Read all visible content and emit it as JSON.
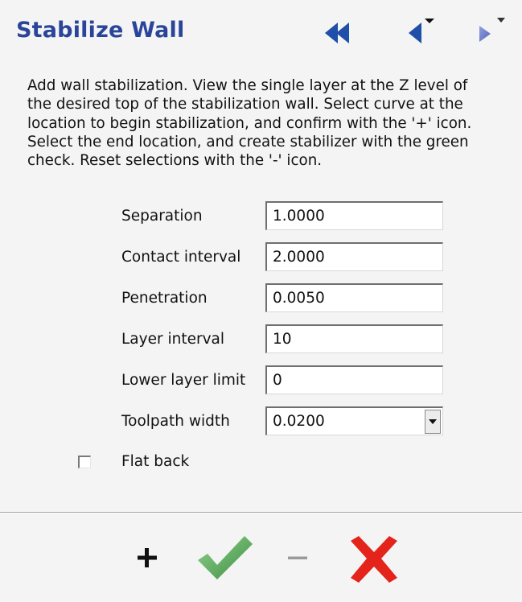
{
  "panel": {
    "title": "Stabilize Wall",
    "description": "Add wall stabilization. View the single layer at the Z level of the desired top of the stabilization wall. Select curve at the location to begin stabilization, and confirm with the '+' icon. Select the end location, and create stabilizer with the green check.  Reset selections with the '-' icon."
  },
  "nav": {
    "icons": [
      "double-left-arrow-icon",
      "left-arrow-icon",
      "right-arrow-icon"
    ],
    "color": "#1f4fa8"
  },
  "params": {
    "separation": {
      "label": "Separation",
      "value": "1.0000"
    },
    "contact_interval": {
      "label": "Contact interval",
      "value": "2.0000"
    },
    "penetration": {
      "label": "Penetration",
      "value": "0.0050"
    },
    "layer_interval": {
      "label": "Layer interval",
      "value": "10"
    },
    "lower_layer_limit": {
      "label": "Lower layer limit",
      "value": "0"
    },
    "toolpath_width": {
      "label": "Toolpath width",
      "value": "0.0200"
    }
  },
  "flat_back": {
    "label": "Flat back",
    "checked": false
  },
  "actions": {
    "icons": [
      "plus-icon",
      "green-check-icon",
      "minus-icon",
      "red-x-icon"
    ],
    "check_color": "#5aa55a",
    "cancel_color": "#e4231b"
  }
}
